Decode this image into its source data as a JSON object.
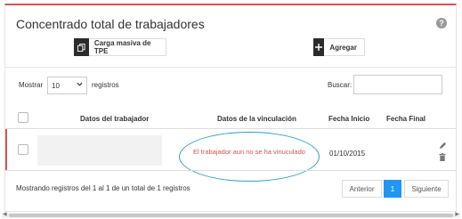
{
  "header": {
    "title": "Concentrado total de trabajadores",
    "help_icon": "question-circle-icon",
    "help_glyph": "?"
  },
  "toolbar": {
    "bulk_label": "Carga masiva de TPE",
    "bulk_icon": "copy-icon",
    "add_label": "Agregar",
    "add_icon": "plus-icon"
  },
  "controls": {
    "show_label": "Mostrar",
    "page_size": "10",
    "records_label": "registros",
    "search_label": "Buscar:",
    "search_value": ""
  },
  "table": {
    "columns": [
      "Datos del trabajador",
      "Datos de la vinculación",
      "Fecha Inicio",
      "Fecha Final"
    ],
    "rows": [
      {
        "worker": "",
        "link_status": "El trabajador aun no se ha vinuculado",
        "start_date": "01/10/2015",
        "end_date": ""
      }
    ]
  },
  "footer": {
    "info": "Mostrando registros del 1 al 1 de un total de 1 registros",
    "prev_label": "Anterior",
    "current_page": "1",
    "next_label": "Siguiente"
  },
  "colors": {
    "accent_red": "#d9534f",
    "pager_active": "#2196f3",
    "highlight": "#2a9fd6"
  }
}
